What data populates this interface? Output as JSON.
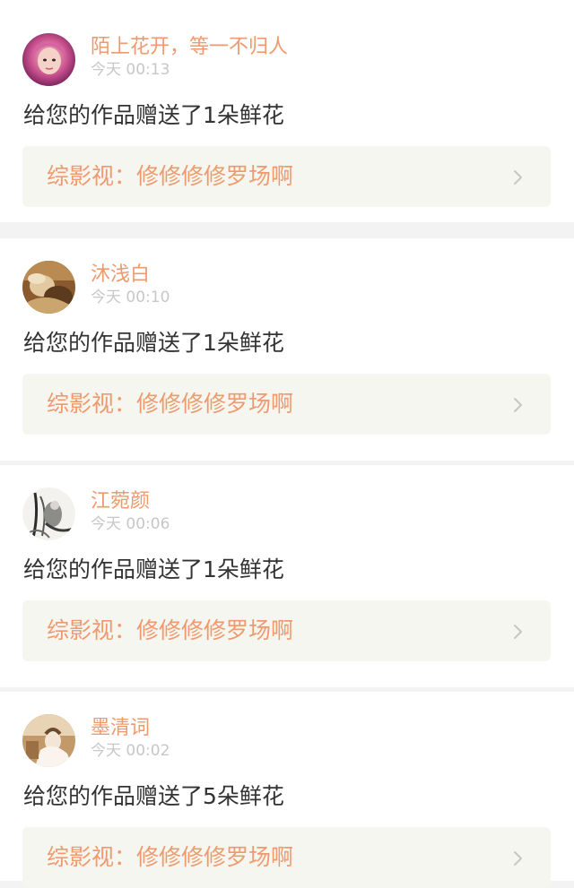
{
  "notifications": [
    {
      "username": "陌上花开，等一不归人",
      "time": "今天 00:13",
      "message": "给您的作品赠送了1朵鲜花",
      "work_title": "综影视：修修修修罗场啊",
      "avatar": "avatar-pink-hair"
    },
    {
      "username": "沐浅白",
      "time": "今天 00:10",
      "message": "给您的作品赠送了1朵鲜花",
      "work_title": "综影视：修修修修罗场啊",
      "avatar": "avatar-sepia-photo"
    },
    {
      "username": "江菀颜",
      "time": "今天 00:06",
      "message": "给您的作品赠送了1朵鲜花",
      "work_title": "综影视：修修修修罗场啊",
      "avatar": "avatar-ink-painting"
    },
    {
      "username": "墨清词",
      "time": "今天 00:02",
      "message": "给您的作品赠送了5朵鲜花",
      "work_title": "综影视：修修修修罗场啊",
      "avatar": "avatar-sepia-figure"
    }
  ],
  "colors": {
    "username": "#ef9a6e",
    "timestamp": "#c7c7c7",
    "message": "#333333",
    "work_title": "#ef9a6e",
    "work_link_bg": "#f6f6f0",
    "divider": "#f3f3f3",
    "tab_indicator": "#f57ba8"
  },
  "icons": {
    "chevron": "chevron-right-icon"
  }
}
